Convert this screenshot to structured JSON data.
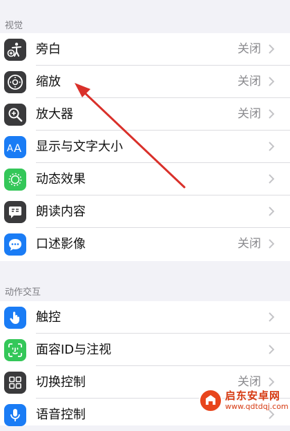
{
  "sections": {
    "vision": {
      "title": "视觉",
      "items": [
        {
          "label": "旁白",
          "value": "关闭"
        },
        {
          "label": "缩放",
          "value": "关闭"
        },
        {
          "label": "放大器",
          "value": "关闭"
        },
        {
          "label": "显示与文字大小",
          "value": ""
        },
        {
          "label": "动态效果",
          "value": ""
        },
        {
          "label": "朗读内容",
          "value": ""
        },
        {
          "label": "口述影像",
          "value": "关闭"
        }
      ]
    },
    "interaction": {
      "title": "动作交互",
      "items": [
        {
          "label": "触控",
          "value": ""
        },
        {
          "label": "面容ID与注视",
          "value": ""
        },
        {
          "label": "切换控制",
          "value": "关闭"
        },
        {
          "label": "语音控制",
          "value": ""
        }
      ]
    }
  },
  "icons": {
    "voiceover": "voiceover-icon",
    "zoom": "zoom-icon",
    "magnifier": "magnifier-icon",
    "text_size": "text-size-icon",
    "motion": "motion-icon",
    "spoken_content": "spoken-content-icon",
    "audio_descriptions": "audio-descriptions-icon",
    "touch": "touch-icon",
    "face_id": "face-id-icon",
    "switch_control": "switch-control-icon",
    "voice_control": "voice-control-icon"
  },
  "colors": {
    "background": "#f2f2f7",
    "annotation_arrow": "#d9302a",
    "blue_icon": "#1a7cf5",
    "green_icon": "#34c759",
    "dark_icon": "#3a3a3c"
  },
  "watermark": {
    "title": "启东安卓网",
    "url": "www.qdtdqj.com"
  }
}
